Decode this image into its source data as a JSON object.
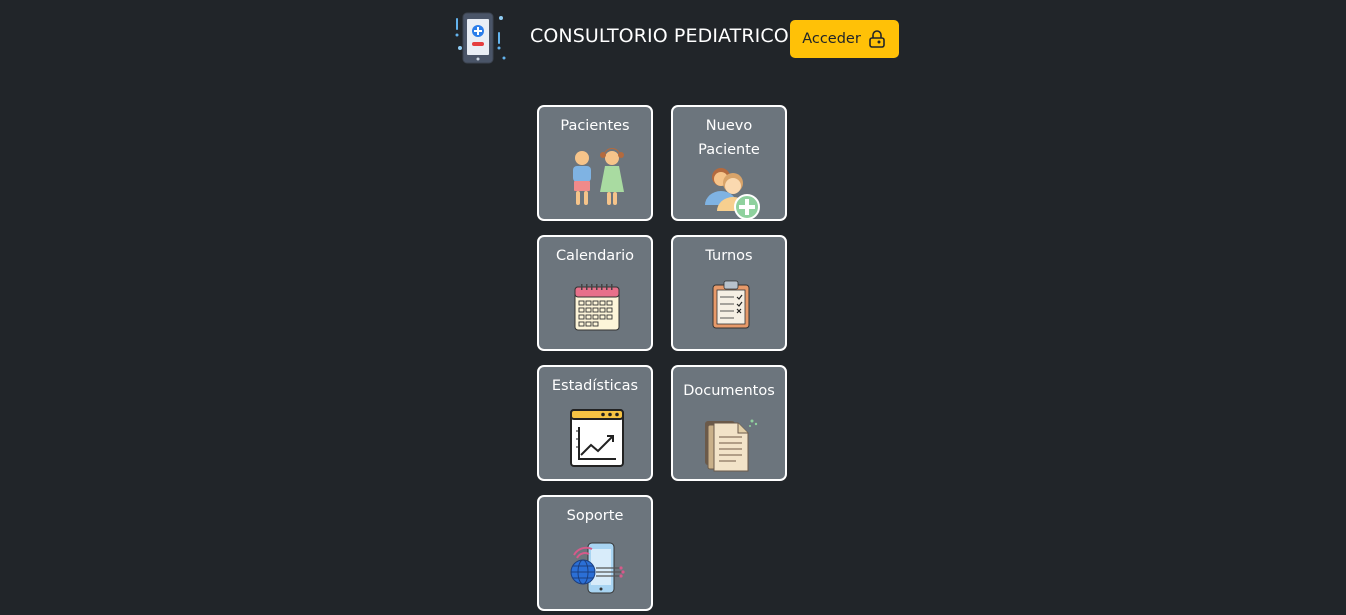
{
  "header": {
    "title": "CONSULTORIO PEDIATRICO",
    "login_label": "Acceder",
    "logo_icon": "medical-phone-icon",
    "login_icon": "padlock-icon"
  },
  "colors": {
    "background": "#212529",
    "tile_bg": "#6c757d",
    "tile_border": "#ffffff",
    "accent": "#ffc107"
  },
  "menu": {
    "items": [
      {
        "label": "Pacientes",
        "icon": "children-icon"
      },
      {
        "label": "Nuevo Paciente",
        "icon": "add-patient-icon"
      },
      {
        "label": "Calendario",
        "icon": "calendar-icon"
      },
      {
        "label": "Turnos",
        "icon": "clipboard-checklist-icon"
      },
      {
        "label": "Estadísticas",
        "icon": "statistics-chart-icon"
      },
      {
        "label": "Documentos",
        "icon": "documents-icon"
      },
      {
        "label": "Soporte",
        "icon": "support-phone-globe-icon"
      }
    ]
  }
}
